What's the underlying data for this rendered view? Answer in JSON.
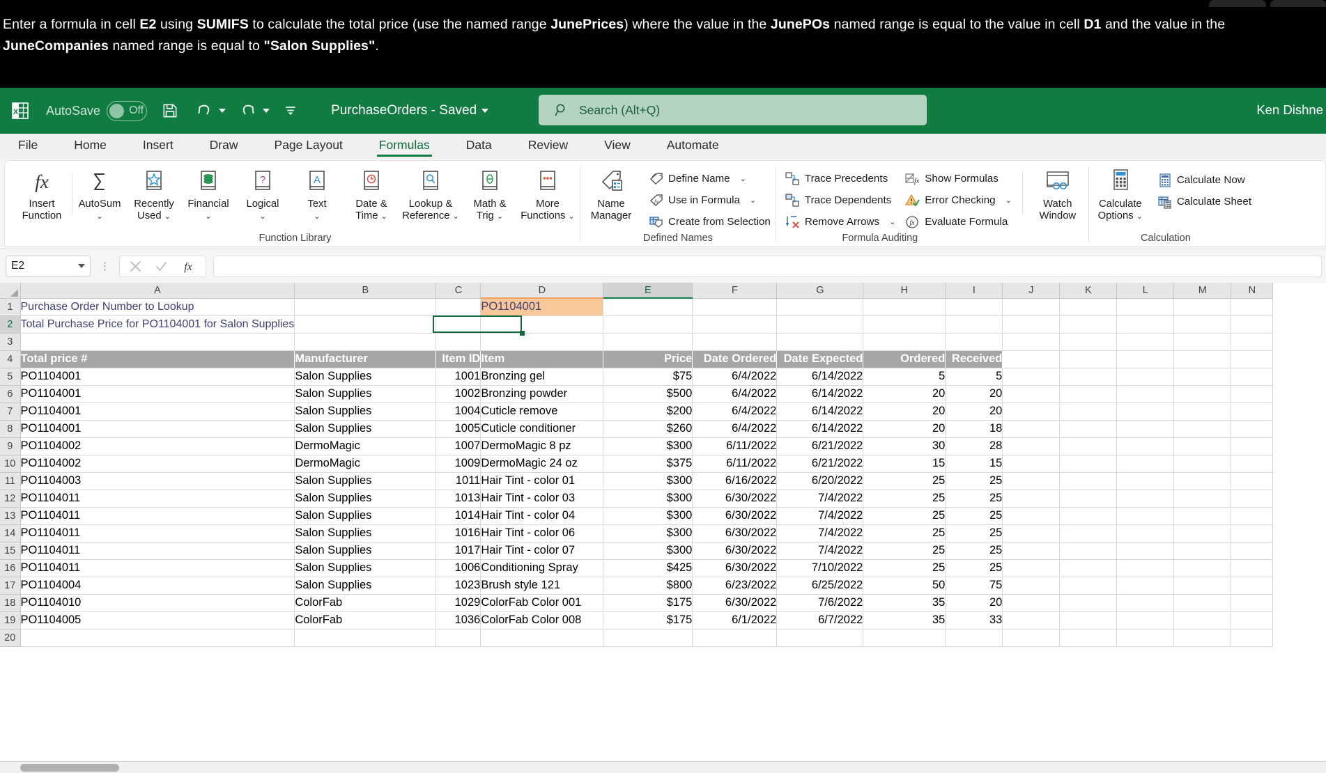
{
  "instruction": {
    "segments": [
      {
        "t": "Enter a formula in cell ",
        "b": false
      },
      {
        "t": "E2",
        "b": true
      },
      {
        "t": " using ",
        "b": false
      },
      {
        "t": "SUMIFS",
        "b": true
      },
      {
        "t": " to calculate the total price (use the named range ",
        "b": false
      },
      {
        "t": "JunePrices",
        "b": true
      },
      {
        "t": ") where the value in the ",
        "b": false
      },
      {
        "t": "JunePOs",
        "b": true
      },
      {
        "t": " named range is equal to the value in cell ",
        "b": false
      },
      {
        "t": "D1",
        "b": true
      },
      {
        "t": " and the value in the ",
        "b": false
      },
      {
        "t": "JuneCompanies",
        "b": true
      },
      {
        "t": " named range is equal to ",
        "b": false
      },
      {
        "t": "\"Salon Supplies\"",
        "b": true
      },
      {
        "t": ".",
        "b": false
      }
    ]
  },
  "titlebar": {
    "autosave_label": "AutoSave",
    "autosave_state": "Off",
    "save_icon": "save-icon",
    "undo_icon": "undo-icon",
    "redo_icon": "redo-icon",
    "customize_icon": "customize-quick-access-icon",
    "document_title": "PurchaseOrders - Saved",
    "user_name": "Ken Dishne",
    "logo_icon": "excel-logo-icon"
  },
  "search": {
    "placeholder": "Search (Alt+Q)",
    "icon": "search-icon"
  },
  "ribbon_tabs": [
    {
      "label": "File",
      "active": false
    },
    {
      "label": "Home",
      "active": false
    },
    {
      "label": "Insert",
      "active": false
    },
    {
      "label": "Draw",
      "active": false
    },
    {
      "label": "Page Layout",
      "active": false
    },
    {
      "label": "Formulas",
      "active": true
    },
    {
      "label": "Data",
      "active": false
    },
    {
      "label": "Review",
      "active": false
    },
    {
      "label": "View",
      "active": false
    },
    {
      "label": "Automate",
      "active": false
    }
  ],
  "ribbon": {
    "groups": [
      {
        "label": "Function Library",
        "buttons": [
          {
            "label1": "Insert",
            "label2": "Function",
            "icon": "insert-function-icon",
            "caret": false
          },
          {
            "label1": "AutoSum",
            "label2": "",
            "icon": "autosum-icon",
            "caret": true
          },
          {
            "label1": "Recently",
            "label2": "Used",
            "icon": "recently-used-icon",
            "caret": true
          },
          {
            "label1": "Financial",
            "label2": "",
            "icon": "financial-icon",
            "caret": true
          },
          {
            "label1": "Logical",
            "label2": "",
            "icon": "logical-icon",
            "caret": true
          },
          {
            "label1": "Text",
            "label2": "",
            "icon": "text-icon",
            "caret": true
          },
          {
            "label1": "Date &",
            "label2": "Time",
            "icon": "date-time-icon",
            "caret": true
          },
          {
            "label1": "Lookup &",
            "label2": "Reference",
            "icon": "lookup-reference-icon",
            "caret": true
          },
          {
            "label1": "Math &",
            "label2": "Trig",
            "icon": "math-trig-icon",
            "caret": true
          },
          {
            "label1": "More",
            "label2": "Functions",
            "icon": "more-functions-icon",
            "caret": true
          }
        ]
      },
      {
        "label": "Defined Names",
        "big": {
          "label1": "Name",
          "label2": "Manager",
          "icon": "name-manager-icon"
        },
        "items": [
          {
            "label": "Define Name",
            "icon": "define-name-icon",
            "caret": true
          },
          {
            "label": "Use in Formula",
            "icon": "use-in-formula-icon",
            "caret": true
          },
          {
            "label": "Create from Selection",
            "icon": "create-from-selection-icon",
            "caret": false
          }
        ]
      },
      {
        "label": "Formula Auditing",
        "colA": [
          {
            "label": "Trace Precedents",
            "icon": "trace-precedents-icon",
            "caret": false
          },
          {
            "label": "Trace Dependents",
            "icon": "trace-dependents-icon",
            "caret": false
          },
          {
            "label": "Remove Arrows",
            "icon": "remove-arrows-icon",
            "caret": true
          }
        ],
        "colB": [
          {
            "label": "Show Formulas",
            "icon": "show-formulas-icon",
            "caret": false
          },
          {
            "label": "Error Checking",
            "icon": "error-checking-icon",
            "caret": true
          },
          {
            "label": "Evaluate Formula",
            "icon": "evaluate-formula-icon",
            "caret": false
          }
        ],
        "watch": {
          "label1": "Watch",
          "label2": "Window",
          "icon": "watch-window-icon"
        }
      },
      {
        "label": "Calculation",
        "big": {
          "label1": "Calculate",
          "label2": "Options",
          "icon": "calculate-options-icon",
          "caret": true
        },
        "items": [
          {
            "label": "Calculate Now",
            "icon": "calculate-now-icon"
          },
          {
            "label": "Calculate Sheet",
            "icon": "calculate-sheet-icon"
          }
        ]
      }
    ]
  },
  "formula_bar": {
    "name_box_value": "E2",
    "cancel_icon": "cancel-icon",
    "enter_icon": "confirm-icon",
    "fx_icon": "insert-function-icon",
    "formula_value": ""
  },
  "grid": {
    "columns": [
      "A",
      "B",
      "C",
      "D",
      "E",
      "F",
      "G",
      "H",
      "I",
      "J",
      "K",
      "L",
      "M",
      "N"
    ],
    "selected_column": "E",
    "highlight_column": "D",
    "selected_row": 2,
    "selected_cell": "E2",
    "rows": [
      {
        "n": 1,
        "cells": {
          "A": "Purchase Order Number to Lookup",
          "D": "PO1104001"
        }
      },
      {
        "n": 2,
        "cells": {
          "A": "Total Purchase Price for PO1104001 for Salon Supplies"
        }
      },
      {
        "n": 3,
        "cells": {}
      },
      {
        "n": 4,
        "cells": {
          "A": "Total price #",
          "B": "Manufacturer",
          "C": "Item ID",
          "D": "Item",
          "E": "Price",
          "F": "Date Ordered",
          "G": "Date Expected",
          "H": "Ordered",
          "I": "Received"
        }
      },
      {
        "n": 5,
        "cells": {
          "A": "PO1104001",
          "B": "Salon Supplies",
          "C": "1001",
          "D": "Bronzing gel",
          "E": "$75",
          "F": "6/4/2022",
          "G": "6/14/2022",
          "H": "5",
          "I": "5"
        }
      },
      {
        "n": 6,
        "cells": {
          "A": "PO1104001",
          "B": "Salon Supplies",
          "C": "1002",
          "D": "Bronzing powder",
          "E": "$500",
          "F": "6/4/2022",
          "G": "6/14/2022",
          "H": "20",
          "I": "20"
        }
      },
      {
        "n": 7,
        "cells": {
          "A": "PO1104001",
          "B": "Salon Supplies",
          "C": "1004",
          "D": "Cuticle remove",
          "E": "$200",
          "F": "6/4/2022",
          "G": "6/14/2022",
          "H": "20",
          "I": "20"
        }
      },
      {
        "n": 8,
        "cells": {
          "A": "PO1104001",
          "B": "Salon Supplies",
          "C": "1005",
          "D": "Cuticle conditioner",
          "E": "$260",
          "F": "6/4/2022",
          "G": "6/14/2022",
          "H": "20",
          "I": "18"
        }
      },
      {
        "n": 9,
        "cells": {
          "A": "PO1104002",
          "B": "DermoMagic",
          "C": "1007",
          "D": "DermoMagic 8 pz",
          "E": "$300",
          "F": "6/11/2022",
          "G": "6/21/2022",
          "H": "30",
          "I": "28"
        }
      },
      {
        "n": 10,
        "cells": {
          "A": "PO1104002",
          "B": "DermoMagic",
          "C": "1009",
          "D": "DermoMagic 24 oz",
          "E": "$375",
          "F": "6/11/2022",
          "G": "6/21/2022",
          "H": "15",
          "I": "15"
        }
      },
      {
        "n": 11,
        "cells": {
          "A": "PO1104003",
          "B": "Salon Supplies",
          "C": "1011",
          "D": "Hair Tint - color 01",
          "E": "$300",
          "F": "6/16/2022",
          "G": "6/20/2022",
          "H": "25",
          "I": "25"
        }
      },
      {
        "n": 12,
        "cells": {
          "A": "PO1104011",
          "B": "Salon Supplies",
          "C": "1013",
          "D": "Hair Tint - color 03",
          "E": "$300",
          "F": "6/30/2022",
          "G": "7/4/2022",
          "H": "25",
          "I": "25"
        }
      },
      {
        "n": 13,
        "cells": {
          "A": "PO1104011",
          "B": "Salon Supplies",
          "C": "1014",
          "D": "Hair Tint - color 04",
          "E": "$300",
          "F": "6/30/2022",
          "G": "7/4/2022",
          "H": "25",
          "I": "25"
        }
      },
      {
        "n": 14,
        "cells": {
          "A": "PO1104011",
          "B": "Salon Supplies",
          "C": "1016",
          "D": "Hair Tint - color 06",
          "E": "$300",
          "F": "6/30/2022",
          "G": "7/4/2022",
          "H": "25",
          "I": "25"
        }
      },
      {
        "n": 15,
        "cells": {
          "A": "PO1104011",
          "B": "Salon Supplies",
          "C": "1017",
          "D": "Hair Tint - color 07",
          "E": "$300",
          "F": "6/30/2022",
          "G": "7/4/2022",
          "H": "25",
          "I": "25"
        }
      },
      {
        "n": 16,
        "cells": {
          "A": "PO1104011",
          "B": "Salon Supplies",
          "C": "1006",
          "D": "Conditioning Spray",
          "E": "$425",
          "F": "6/30/2022",
          "G": "7/10/2022",
          "H": "25",
          "I": "25"
        }
      },
      {
        "n": 17,
        "cells": {
          "A": "PO1104004",
          "B": "Salon Supplies",
          "C": "1023",
          "D": "Brush style 121",
          "E": "$800",
          "F": "6/23/2022",
          "G": "6/25/2022",
          "H": "50",
          "I": "75"
        }
      },
      {
        "n": 18,
        "cells": {
          "A": "PO1104010",
          "B": "ColorFab",
          "C": "1029",
          "D": "ColorFab Color 001",
          "E": "$175",
          "F": "6/30/2022",
          "G": "7/6/2022",
          "H": "35",
          "I": "20"
        }
      },
      {
        "n": 19,
        "cells": {
          "A": "PO1104005",
          "B": "ColorFab",
          "C": "1036",
          "D": "ColorFab Color 008",
          "E": "$175",
          "F": "6/1/2022",
          "G": "6/7/2022",
          "H": "35",
          "I": "33"
        }
      },
      {
        "n": 20,
        "cells": {}
      }
    ]
  },
  "colors": {
    "excel_green": "#107c41",
    "selection_green": "#0f6b3d",
    "highlight_peach": "#f8c79a",
    "header_gray": "#a6a6a6"
  }
}
